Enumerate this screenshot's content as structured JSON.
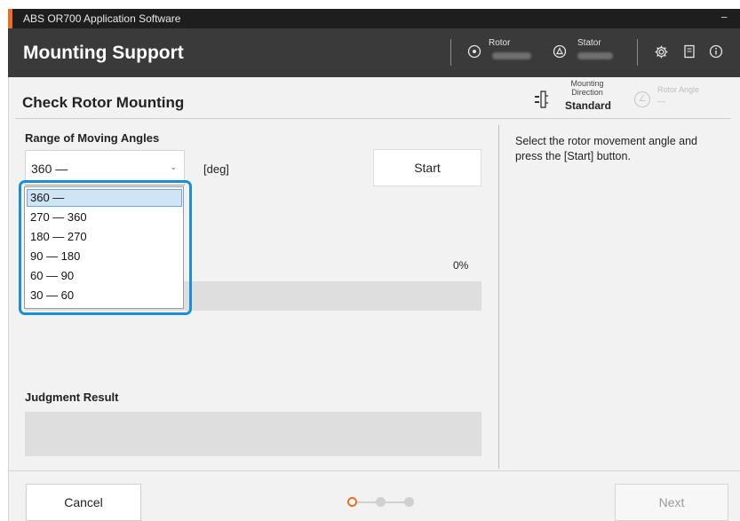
{
  "window": {
    "title": "ABS OR700 Application Software",
    "minimize_glyph": "−"
  },
  "header": {
    "title": "Mounting Support",
    "rotor_label": "Rotor",
    "stator_label": "Stator"
  },
  "page": {
    "title": "Check Rotor Mounting",
    "mounting_direction": {
      "label": "Mounting Direction",
      "value": "Standard"
    },
    "rotor_angle": {
      "label": "Rotor Angle",
      "value": "—"
    }
  },
  "form": {
    "range_label": "Range of Moving Angles",
    "selected_range": "360 —",
    "unit": "[deg]",
    "start_label": "Start",
    "progress_text": "0%",
    "progress_value": 0,
    "judgment_label": "Judgment Result"
  },
  "dropdown": {
    "options": [
      "360 —",
      "270 — 360",
      "180 — 270",
      "90 — 180",
      "60 — 90",
      "30 — 60"
    ],
    "selected_index": 0
  },
  "instructions": "Select the rotor movement angle and press the [Start] button.",
  "footer": {
    "cancel_label": "Cancel",
    "next_label": "Next",
    "steps_total": 3,
    "current_step": 1
  },
  "colors": {
    "accent": "#f26b21",
    "header_bg": "#3a3a3a",
    "highlight": "#1a8fd6"
  },
  "icons": {
    "rotor": "target-circle-icon",
    "stator": "triangle-circle-icon",
    "settings": "gear-icon",
    "manual": "book-icon",
    "info": "info-icon",
    "mounting_direction": "mounting-direction-icon",
    "rotor_angle": "angle-gauge-icon"
  }
}
